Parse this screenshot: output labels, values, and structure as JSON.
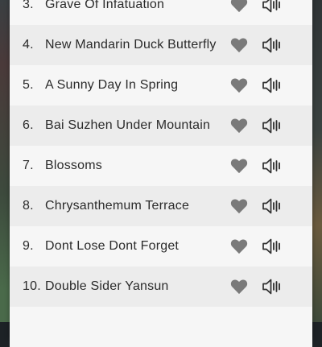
{
  "playlist": {
    "items": [
      {
        "number": "3.",
        "title": "Grave Of Infatuation",
        "heart_icon": "heart-icon",
        "speaker_icon": "speaker-icon"
      },
      {
        "number": "4.",
        "title": "New Mandarin Duck Butterfly",
        "heart_icon": "heart-icon",
        "speaker_icon": "speaker-icon"
      },
      {
        "number": "5.",
        "title": "A Sunny Day In Spring",
        "heart_icon": "heart-icon",
        "speaker_icon": "speaker-icon"
      },
      {
        "number": "6.",
        "title": "Bai Suzhen Under Mountain",
        "heart_icon": "heart-icon",
        "speaker_icon": "speaker-icon"
      },
      {
        "number": "7.",
        "title": "Blossoms",
        "heart_icon": "heart-icon",
        "speaker_icon": "speaker-icon"
      },
      {
        "number": "8.",
        "title": "Chrysanthemum Terrace",
        "heart_icon": "heart-icon",
        "speaker_icon": "speaker-icon"
      },
      {
        "number": "9.",
        "title": "Dont Lose Dont Forget",
        "heart_icon": "heart-icon",
        "speaker_icon": "speaker-icon"
      },
      {
        "number": "10.",
        "title": "Double Sider Yansun",
        "heart_icon": "heart-icon",
        "speaker_icon": "speaker-icon"
      }
    ]
  },
  "colors": {
    "row_light": "#f6f6f6",
    "row_dark": "#ececec",
    "text": "#2b2b2b",
    "icon": "#7a7a7a"
  }
}
